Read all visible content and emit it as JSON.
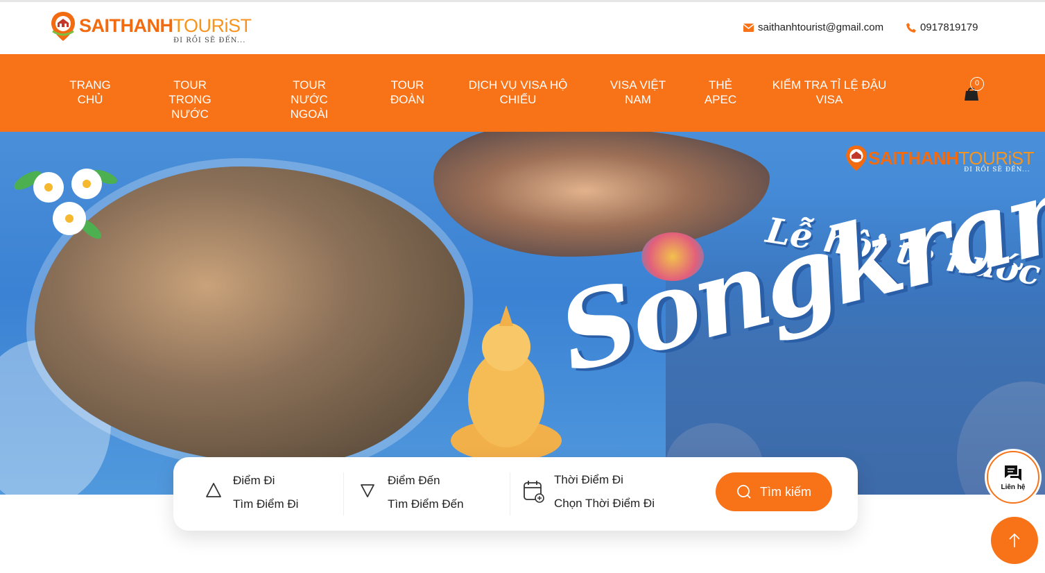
{
  "brand": {
    "logo_part1": "SAITHANH",
    "logo_part2": "TOURiST",
    "tagline": "ĐI RỒI SẼ ĐẾN..."
  },
  "header": {
    "email": "saithanhtourist@gmail.com",
    "phone": "0917819179"
  },
  "nav": {
    "items": [
      {
        "line1": "TRANG",
        "line2": "CHỦ"
      },
      {
        "line1": "TOUR TRONG",
        "line2": "NƯỚC"
      },
      {
        "line1": "TOUR NƯỚC",
        "line2": "NGOÀI"
      },
      {
        "line1": "TOUR",
        "line2": "ĐOÀN"
      },
      {
        "line1": "DỊCH VỤ VISA HỘ",
        "line2": "CHIẾU"
      },
      {
        "line1": "VISA VIỆT",
        "line2": "NAM"
      },
      {
        "line1": "THẺ",
        "line2": "APEC"
      },
      {
        "line1": "KIỂM TRA TỈ LỆ ĐẬU",
        "line2": "VISA"
      }
    ],
    "cart_count": "0"
  },
  "banner": {
    "logo_part1": "SAITHANH",
    "logo_part2": "TOURiST",
    "tagline": "ĐI RỒI SẼ ĐẾN...",
    "festival_text": "Lễ hội té nước",
    "headline": "Songkran"
  },
  "search": {
    "from_label": "Điểm Đi",
    "from_value": "Tìm Điểm Đi",
    "to_label": "Điểm Đến",
    "to_value": "Tìm Điểm Đến",
    "date_label": "Thời Điểm Đi",
    "date_value": "Chọn Thời Điểm Đi",
    "button": "Tìm kiếm"
  },
  "floating": {
    "contact_label": "Liên hệ"
  },
  "colors": {
    "primary": "#f87218",
    "brand_orange": "#f26b10",
    "banner_blue": "#3b82d4"
  }
}
